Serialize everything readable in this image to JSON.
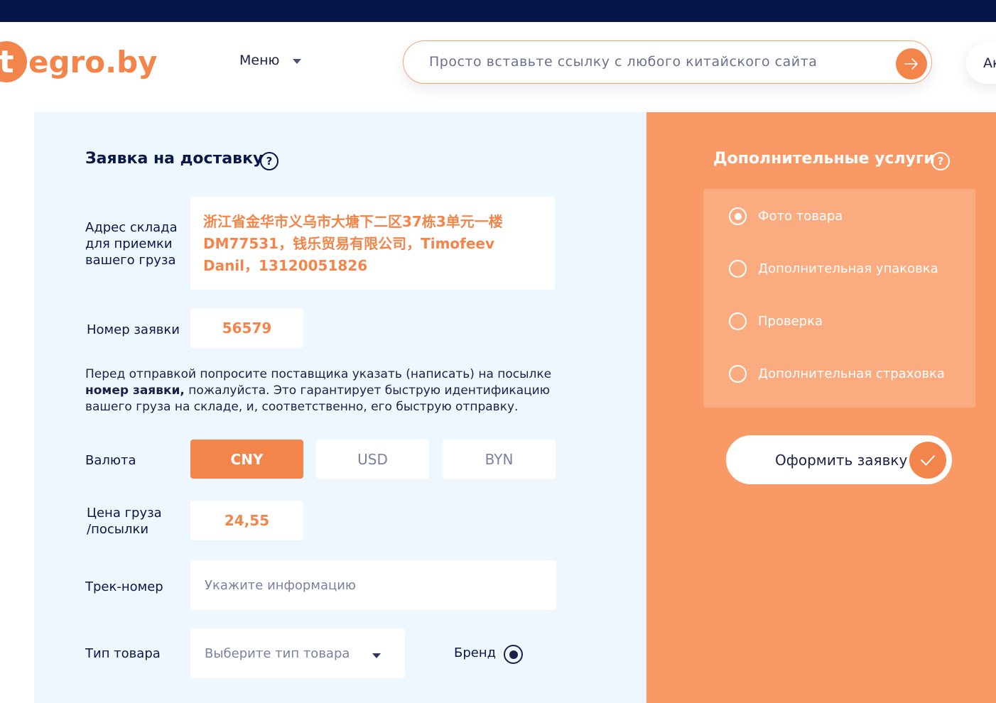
{
  "header": {
    "logo_letter": "t",
    "logo_text": "egro.by",
    "menu_label": "Меню",
    "search_placeholder": "Просто вставьте ссылку с любого китайского сайта",
    "account_label": "Ак"
  },
  "form": {
    "title": "Заявка на доставку",
    "address_label": "Адрес склада для приемки вашего груза",
    "address_value": "浙江省金华市义乌市大塘下二区37栋3单元一楼DM77531，钱乐贸易有限公司，Timofeev Danil，13120051826",
    "order_label": "Номер заявки",
    "order_value": "56579",
    "note_part1": "Перед отправкой попросите поставщика указать (написать) на посылке ",
    "note_bold": "номер заявки,",
    "note_part2": " пожалуйста.  Это гарантирует быструю идентификацию вашего груза на складе, и, соответственно, его быструю отправку.",
    "currency_label": "Валюта",
    "currencies": [
      "CNY",
      "USD",
      "BYN"
    ],
    "selected_currency": "CNY",
    "price_label": "Цена груза /посылки",
    "price_value": "24,55",
    "track_label": "Трек-номер",
    "track_placeholder": "Укажите информацию",
    "type_label": "Тип товара",
    "type_placeholder": "Выберите тип товара",
    "brand_label": "Бренд",
    "brand_selected": true
  },
  "services": {
    "title": "Дополнительные услуги",
    "options": [
      {
        "label": "Фото товара",
        "selected": true
      },
      {
        "label": "Дополнительная упаковка",
        "selected": false
      },
      {
        "label": "Проверка",
        "selected": false
      },
      {
        "label": "Дополнительная страховка",
        "selected": false
      }
    ],
    "submit_label": "Оформить заявку"
  },
  "colors": {
    "accent": "#f4854a",
    "navy": "#051449",
    "panel_light": "#eef6fe",
    "panel_orange": "#f99a66"
  },
  "icons": {
    "search_button": "arrow-right-icon",
    "help": "question-circle-icon",
    "dropdown": "chevron-down-icon",
    "submit": "check-icon"
  }
}
